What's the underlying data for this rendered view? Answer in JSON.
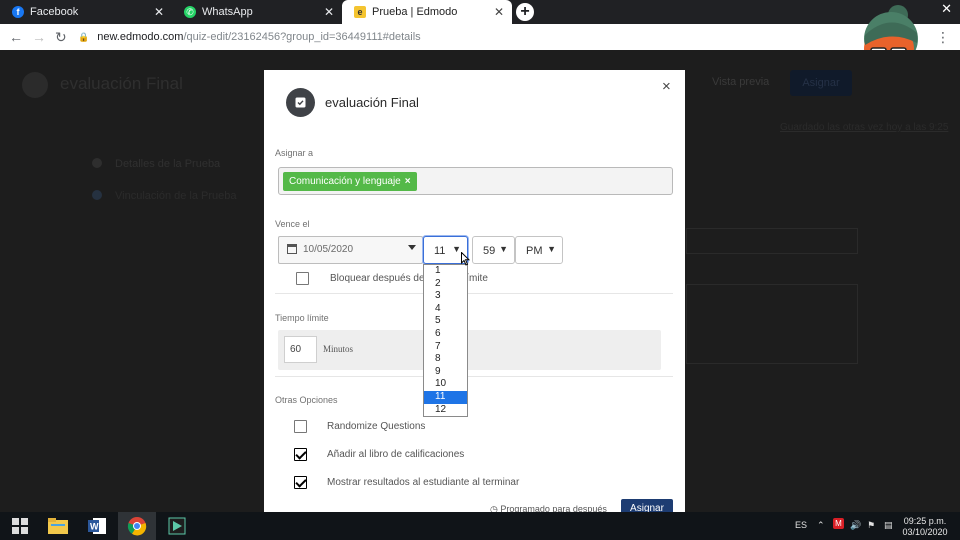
{
  "browser": {
    "tabs": [
      {
        "label": "Facebook",
        "icon": "facebook-icon",
        "active": false
      },
      {
        "label": "WhatsApp",
        "icon": "whatsapp-icon",
        "active": false
      },
      {
        "label": "Prueba | Edmodo",
        "icon": "edmodo-icon",
        "active": true
      }
    ],
    "address": {
      "host": "new.edmodo.com",
      "path": "/quiz-edit/23162456?group_id=36449111#details"
    }
  },
  "page": {
    "title": "evaluación Final",
    "sidebar": [
      "Detalles de la Prueba",
      "Vinculación de la Prueba"
    ],
    "preview_label": "Vista previa",
    "assign_label": "Asignar",
    "subheading": "Guardado las otras vez hoy a las 9:25"
  },
  "modal": {
    "title": "evaluación Final",
    "close": "×",
    "assign_label": "Asignar a",
    "assign_chip": "Comunicación y lenguaje",
    "due_label": "Vence el",
    "due_date": "10/05/2020",
    "hour": "11",
    "minute": "59",
    "ampm": "PM",
    "lock_label": "Bloquear después de la hora Límite",
    "time_limit_label": "Tiempo límite",
    "time_limit_value": "60",
    "time_limit_unit": "Minutos",
    "other_label": "Otras Opciones",
    "options": [
      {
        "label": "Randomize Questions",
        "checked": false
      },
      {
        "label": "Añadir al libro de calificaciones",
        "checked": true
      },
      {
        "label": "Mostrar resultados al estudiante al terminar",
        "checked": true
      }
    ],
    "footer_link": "Programado para después",
    "footer_button": "Asignar",
    "hour_options": [
      "1",
      "2",
      "3",
      "4",
      "5",
      "6",
      "7",
      "8",
      "9",
      "10",
      "11",
      "12"
    ],
    "selected_hour": "11"
  },
  "taskbar": {
    "lang": "ES",
    "time": "09:25 p.m.",
    "date": "03/10/2020"
  },
  "colors": {
    "chip_green": "#54b948",
    "selected_blue": "#1e74e6",
    "assign_button": "#1d3c72"
  }
}
